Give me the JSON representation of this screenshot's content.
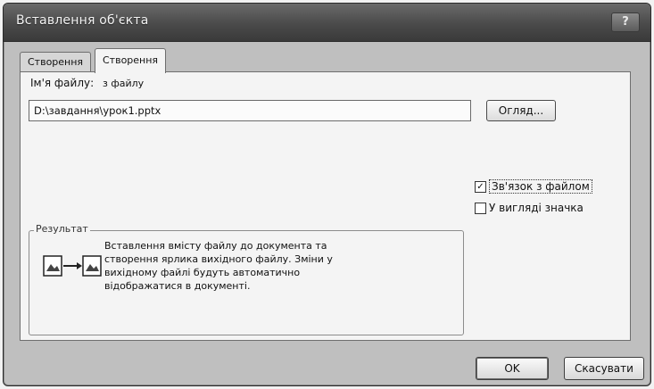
{
  "window": {
    "title": "Вставлення об'єкта",
    "help_label": "?"
  },
  "tabs": [
    {
      "label": "Створення"
    },
    {
      "label": "Створення з файлу"
    }
  ],
  "file": {
    "label": "Ім'я файлу:",
    "value": "D:\\завдання\\урок1.pptx",
    "browse_label": "Огляд..."
  },
  "options": {
    "link_label": "Зв'язок з файлом",
    "link_checked": true,
    "icon_label": "У вигляді значка",
    "icon_checked": false
  },
  "result": {
    "legend": "Результат",
    "text": "Вставлення вмісту файлу до документа та створення ярлика вихідного файлу. Зміни у вихідному файлі будуть автоматично відображатися в документі."
  },
  "buttons": {
    "ok_label": "OK",
    "cancel_label": "Скасувати"
  },
  "icons": [
    "help-icon",
    "result-link-icon"
  ]
}
